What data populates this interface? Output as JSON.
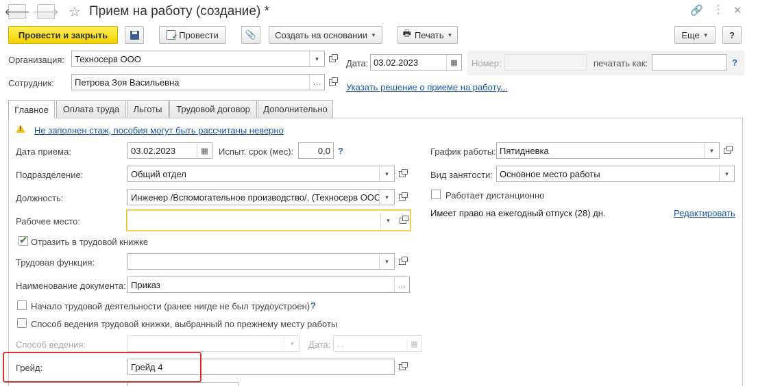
{
  "window": {
    "title": "Прием на работу (создание) *",
    "more_label": "Еще",
    "help_label": "?"
  },
  "toolbar": {
    "post_close": "Провести и закрыть",
    "post": "Провести",
    "create_based": "Создать на основании",
    "print": "Печать"
  },
  "header": {
    "org_label": "Организация:",
    "org_value": "Техносерв ООО",
    "employee_label": "Сотрудник:",
    "employee_value": "Петрова Зоя Васильевна",
    "date_label": "Дата:",
    "date_value": "03.02.2023",
    "number_label": "Номер:",
    "number_value": "",
    "print_as_label": "печатать как:",
    "print_as_value": "",
    "decision_link": "Указать решение о приеме на работу..."
  },
  "tabs": [
    {
      "label": "Главное"
    },
    {
      "label": "Оплата труда"
    },
    {
      "label": "Льготы"
    },
    {
      "label": "Трудовой договор"
    },
    {
      "label": "Дополнительно"
    }
  ],
  "main": {
    "warning": "Не заполнен стаж, пособия могут быть рассчитаны неверно",
    "hire_date_label": "Дата приема:",
    "hire_date_value": "03.02.2023",
    "probation_label": "Испыт. срок (мес):",
    "probation_value": "0,0",
    "dept_label": "Подразделение:",
    "dept_value": "Общий отдел",
    "position_label": "Должность:",
    "position_value": "Инженер /Вспомогательное производство/, (Техносерв ООО)",
    "workplace_label": "Рабочее место:",
    "workplace_value": "",
    "labor_book_label": "Отразить в трудовой книжке",
    "labor_function_label": "Трудовая функция:",
    "labor_function_value": "",
    "doc_name_label": "Наименование документа:",
    "doc_name_value": "Приказ",
    "first_job_label": "Начало трудовой деятельности (ранее нигде не был трудоустроен)",
    "book_method_label": "Способ ведения трудовой книжки, выбранный по прежнему месту работы",
    "method_label": "Способ ведения:",
    "method_value": "",
    "method_date_label": "Дата:",
    "method_date_value": " .  .",
    "grade_label": "Грейд:",
    "grade_value": "Грейд 4",
    "schedule_label": "График работы:",
    "schedule_value": "Пятидневка",
    "employment_label": "Вид занятости:",
    "employment_value": "Основное место работы",
    "remote_label": "Работает дистанционно",
    "vacation_text": "Имеет право на ежегодный отпуск (28) дн.",
    "edit_link": "Редактировать"
  },
  "colors": {
    "primary_button": "#f3d100",
    "link": "#1b56a6",
    "highlight": "#d9322a",
    "focus": "#f1c232"
  }
}
